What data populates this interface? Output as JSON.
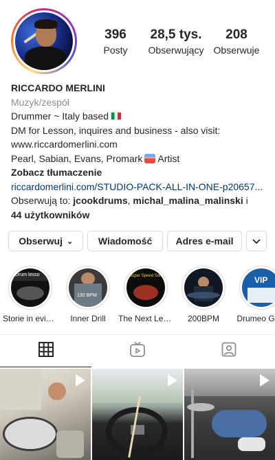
{
  "profile": {
    "name": "RICCARDO MERLINI",
    "category": "Muzyk/zespół",
    "bio_line1": "Drummer ~ Italy based",
    "bio_line2": "DM for Lesson, inquires and business - also visit:",
    "bio_line3": "www.riccardomerlini.com",
    "bio_line4a": "Pearl, Sabian, Evans, Promark",
    "bio_line4b": "Artist",
    "translate": "Zobacz tłumaczenie",
    "link": "riccardomerlini.com/STUDIO-PACK-ALL-IN-ONE-p20657...",
    "followed_by_prefix": "Obserwują to: ",
    "followed_by_user1": "jcookdrums",
    "followed_by_sep": ", ",
    "followed_by_user2": "michal_malina_malinski",
    "followed_by_and": " i",
    "followed_by_count": "44 użytkowników"
  },
  "stats": [
    {
      "value": "396",
      "label": "Posty"
    },
    {
      "value": "28,5 tys.",
      "label": "Obserwujący"
    },
    {
      "value": "208",
      "label": "Obserwuje"
    }
  ],
  "actions": {
    "follow": "Obserwuj",
    "message": "Wiadomość",
    "email": "Adres e-mail"
  },
  "highlights": [
    {
      "label": "Storie in evidenza"
    },
    {
      "label": "Inner Drill"
    },
    {
      "label": "The Next Level"
    },
    {
      "label": "200BPM"
    },
    {
      "label": "Drumeo Gold"
    }
  ],
  "highlight_text": {
    "h1": "Drum lesso",
    "h2": "130 BPM",
    "h3": "Super Speed Solo",
    "h5": "VIP"
  },
  "icons": {
    "grid": "grid-icon",
    "igtv": "igtv-icon",
    "tagged": "tagged-icon",
    "play": "play-icon"
  }
}
